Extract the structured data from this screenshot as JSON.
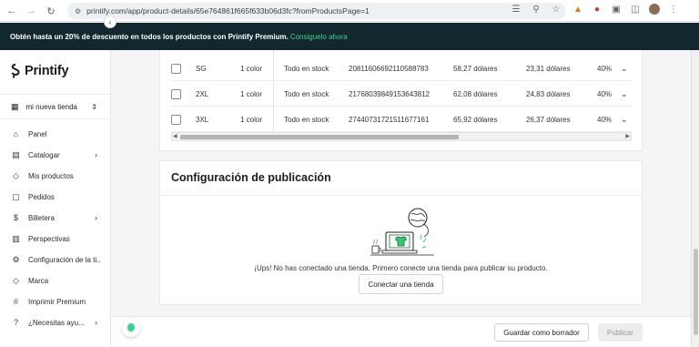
{
  "browser": {
    "url": "printify.com/app/product-details/65e764861f665f633b06d3fc?fromProductsPage=1"
  },
  "promo": {
    "text": "Obtén hasta un 20% de descuento en todos los productos con Printify Premium.",
    "link": "Consiguelo ahora"
  },
  "sidebar": {
    "logo": "Printify",
    "store": "mi nueva tienda",
    "items": [
      {
        "label": "Panel",
        "icon": "home-icon",
        "has_chevron": false
      },
      {
        "label": "Catalogar",
        "icon": "shirt-icon",
        "has_chevron": true
      },
      {
        "label": "Mis productos",
        "icon": "tag-icon",
        "has_chevron": false
      },
      {
        "label": "Pedidos",
        "icon": "box-icon",
        "has_chevron": false
      },
      {
        "label": "Billetera",
        "icon": "dollar-icon",
        "has_chevron": true
      },
      {
        "label": "Perspectivas",
        "icon": "chart-icon",
        "has_chevron": false
      },
      {
        "label": "Configuración de la ti...",
        "icon": "gear-icon",
        "has_chevron": false
      },
      {
        "label": "Marca",
        "icon": "tag-icon",
        "has_chevron": false
      },
      {
        "label": "Imprimir Premium",
        "icon": "crown-icon",
        "has_chevron": false
      },
      {
        "label": "¿Necesitas ayu...",
        "icon": "help-icon",
        "has_chevron": true
      }
    ]
  },
  "variants": {
    "rows": [
      {
        "size": "SG",
        "colors": "1 color",
        "stock": "Todo en stock",
        "sku": "20811606692110588783",
        "price": "58,27 dólares",
        "profit": "23,31 dólares",
        "margin": "40%"
      },
      {
        "size": "2XL",
        "colors": "1 color",
        "stock": "Todo en stock",
        "sku": "21768039849153643812",
        "price": "62,08 dólares",
        "profit": "24,83 dólares",
        "margin": "40%"
      },
      {
        "size": "3XL",
        "colors": "1 color",
        "stock": "Todo en stock",
        "sku": "27440731721511677161",
        "price": "65,92 dólares",
        "profit": "26,37 dólares",
        "margin": "40%"
      }
    ]
  },
  "publishing": {
    "title": "Configuración de publicación",
    "message": "¡Ups! No has conectado una tienda. Primero conecte una tienda para publicar su producto.",
    "connect_label": "Conectar una tienda"
  },
  "footer": {
    "draft_label": "Guardar como borrador",
    "publish_label": "Publicar"
  },
  "colors": {
    "promo_bg": "#12282e",
    "brand_green": "#3fd18a"
  }
}
